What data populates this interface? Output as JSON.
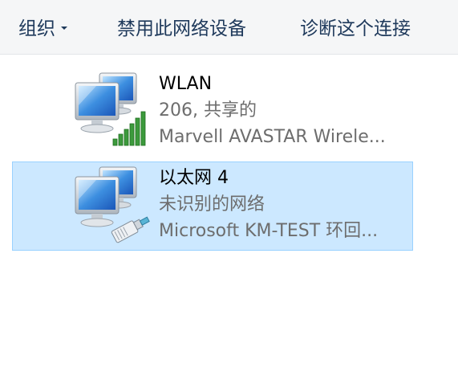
{
  "toolbar": {
    "organize_label": "组织",
    "disable_label": "禁用此网络设备",
    "diagnose_label": "诊断这个连接"
  },
  "connections": [
    {
      "name": "WLAN",
      "status": "206, 共享的",
      "device": "Marvell AVASTAR Wirele...",
      "icon": "wireless-network-icon",
      "selected": false
    },
    {
      "name": "以太网 4",
      "status": "未识别的网络",
      "device": "Microsoft KM-TEST 环回...",
      "icon": "ethernet-network-icon",
      "selected": true
    }
  ],
  "colors": {
    "toolbar_bg": "#f5f6f7",
    "toolbar_text": "#1e395b",
    "selection_bg": "#cce8ff",
    "selection_border": "#99d1ff",
    "signal_green": "#3c9a3c",
    "secondary_text": "#6d6d6d"
  }
}
